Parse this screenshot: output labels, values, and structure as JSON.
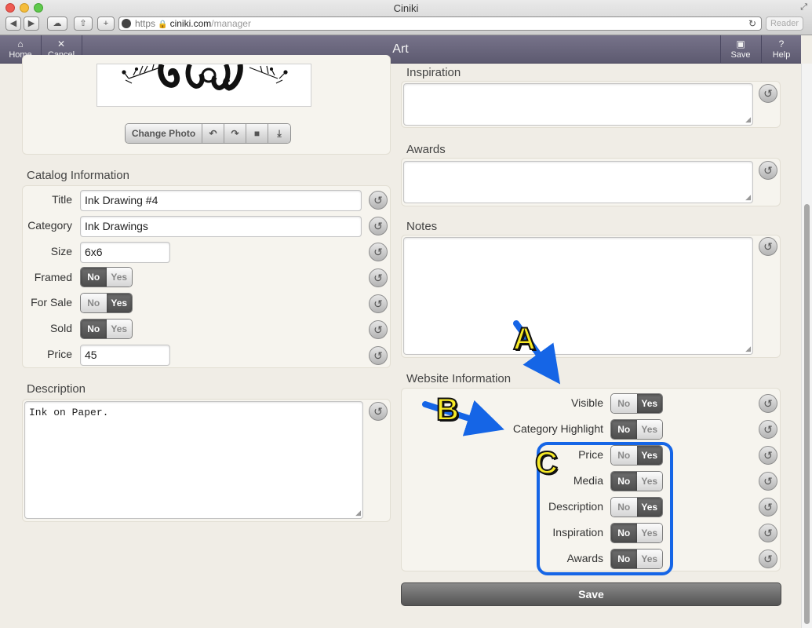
{
  "browser": {
    "title": "Ciniki",
    "url_proto": "https",
    "url_host": "ciniki.com",
    "url_path": "/manager",
    "reader": "Reader"
  },
  "appbar": {
    "title": "Art",
    "home": "Home",
    "cancel": "Cancel",
    "save": "Save",
    "help": "Help"
  },
  "photo": {
    "change_label": "Change Photo"
  },
  "catalog": {
    "section": "Catalog Information",
    "title_label": "Title",
    "title_value": "Ink Drawing #4",
    "category_label": "Category",
    "category_value": "Ink Drawings",
    "size_label": "Size",
    "size_value": "6x6",
    "framed_label": "Framed",
    "forsale_label": "For Sale",
    "sold_label": "Sold",
    "price_label": "Price",
    "price_value": "45"
  },
  "description": {
    "section": "Description",
    "value": "Ink on Paper."
  },
  "right": {
    "inspiration": "Inspiration",
    "awards": "Awards",
    "notes": "Notes"
  },
  "website": {
    "section": "Website Information",
    "visible": "Visible",
    "category_highlight": "Category Highlight",
    "price": "Price",
    "media": "Media",
    "description": "Description",
    "inspiration": "Inspiration",
    "awards": "Awards"
  },
  "toggle": {
    "no": "No",
    "yes": "Yes"
  },
  "save_button": "Save",
  "callouts": {
    "a": "A",
    "b": "B",
    "c": "C"
  },
  "colors": {
    "callout_blue": "#1565e6",
    "callout_yellow": "#f7ea26",
    "appbar": "#6a6780"
  }
}
